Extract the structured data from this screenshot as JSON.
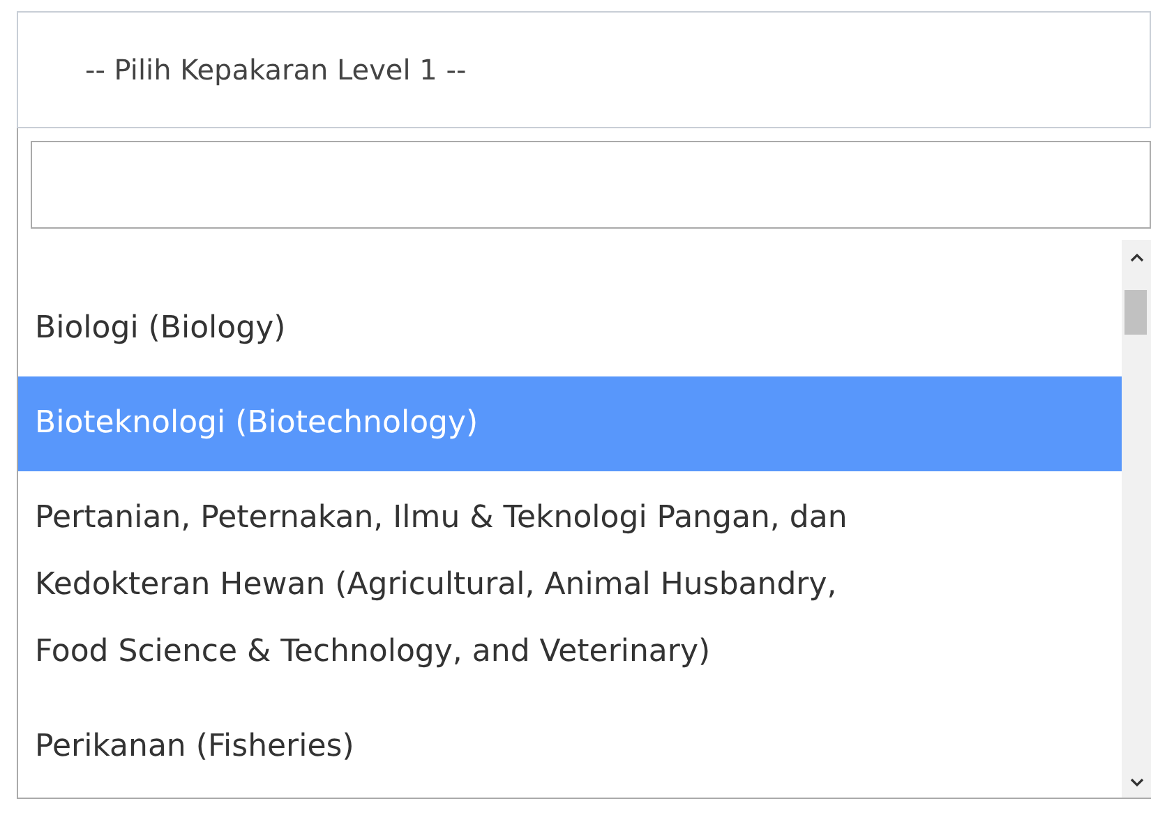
{
  "select": {
    "placeholder": "-- Pilih Kepakaran Level 1 --"
  },
  "dropdown": {
    "options": [
      {
        "label": "Biologi (Biology)",
        "selected": false
      },
      {
        "label": "Bioteknologi (Biotechnology)",
        "selected": true
      },
      {
        "label": "Pertanian, Peternakan, Ilmu & Teknologi Pangan, dan Kedokteran Hewan (Agricultural, Animal Husbandry, Food Science & Technology, and Veterinary)",
        "selected": false
      },
      {
        "label": "Perikanan (Fisheries)",
        "selected": false
      }
    ]
  }
}
